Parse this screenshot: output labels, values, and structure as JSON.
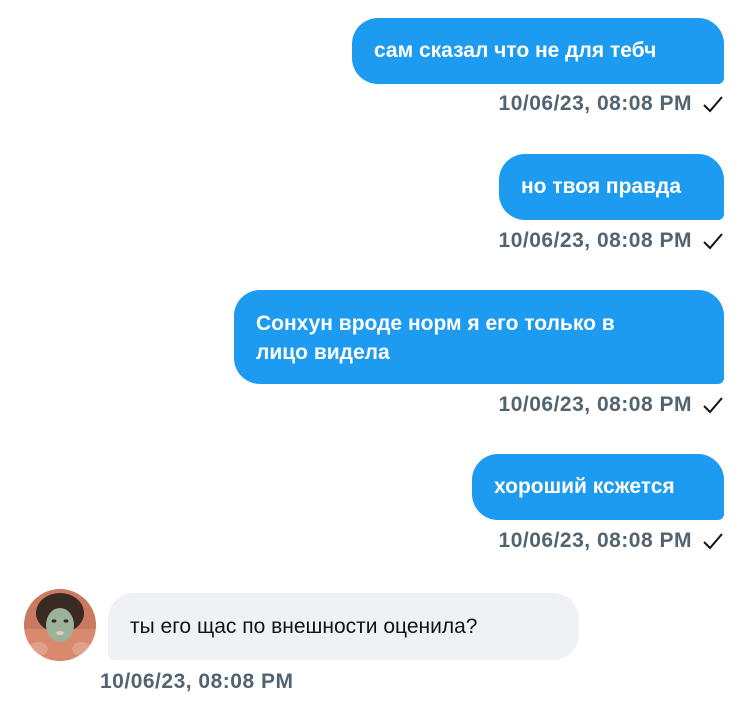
{
  "messages": [
    {
      "text": "сам сказал что не для тебч",
      "time": "10/06/23, 08:08 PM",
      "direction": "outgoing",
      "status_icon": "check-icon"
    },
    {
      "text": "но твоя правда",
      "time": "10/06/23, 08:08 PM",
      "direction": "outgoing",
      "status_icon": "check-icon"
    },
    {
      "text": "Сонхун вроде норм я его только в\nлицо видела",
      "time": "10/06/23, 08:08 PM",
      "direction": "outgoing",
      "status_icon": "check-icon"
    },
    {
      "text": "хороший ксжется",
      "time": "10/06/23, 08:08 PM",
      "direction": "outgoing",
      "status_icon": "check-icon"
    },
    {
      "text": "ты его щас по внешности оценила?",
      "time": "10/06/23, 08:08 PM",
      "direction": "incoming",
      "avatar_icon": "avatar"
    }
  ],
  "colors": {
    "outgoing_bubble": "#1d9bf0",
    "incoming_bubble": "#eff1f5",
    "timestamp": "#536471"
  }
}
